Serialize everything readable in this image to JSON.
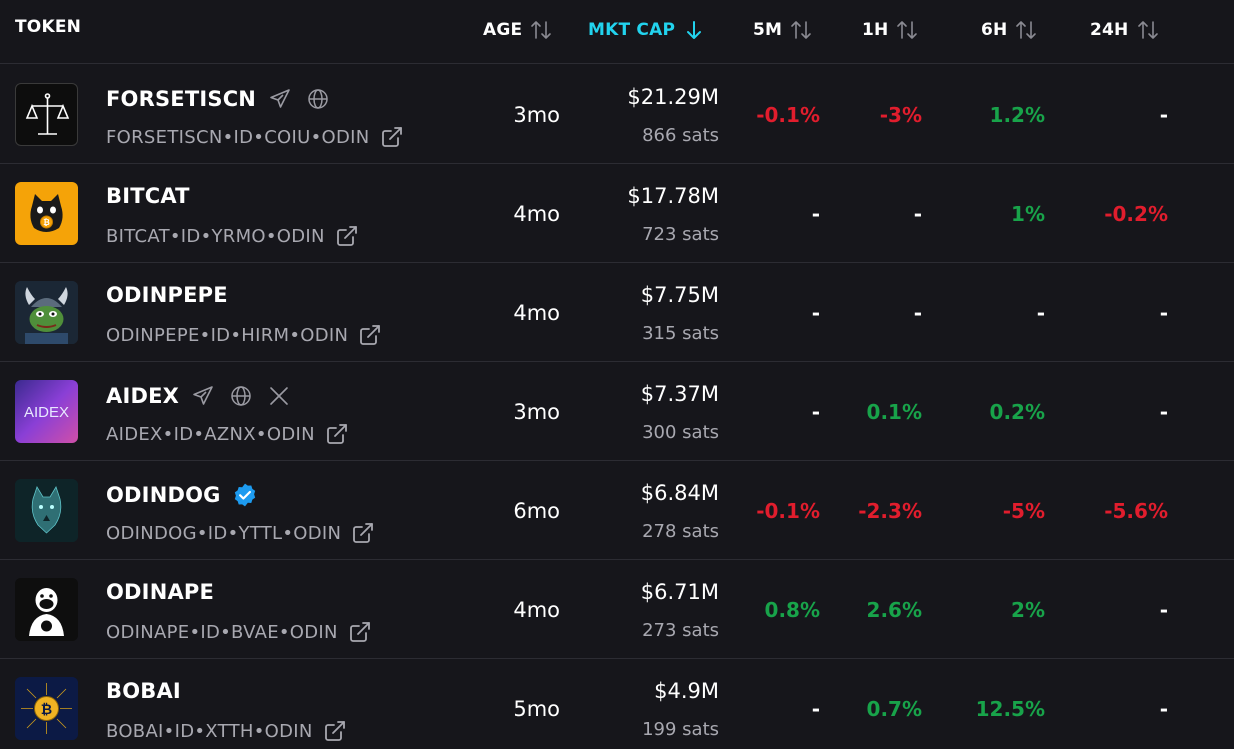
{
  "header": {
    "token": "TOKEN",
    "age": "AGE",
    "mktcap": "MKT CAP",
    "m5": "5M",
    "h1": "1H",
    "h6": "6H",
    "h24": "24H"
  },
  "colors": {
    "background": "#16161b",
    "accent": "#22d3ee",
    "positive": "#18a34a",
    "negative": "#e11d2d",
    "muted": "#a8a8b0",
    "verified": "#1d9bf0"
  },
  "rows": [
    {
      "name": "FORSETISCN",
      "id": "FORSETISCN•ID•COIU•ODIN",
      "age": "3mo",
      "cap": "$21.29M",
      "sats": "866 sats",
      "m5": "-0.1%",
      "h1": "-3%",
      "h6": "1.2%",
      "h24": "-",
      "icons": [
        "telegram-icon",
        "globe-icon"
      ]
    },
    {
      "name": "BITCAT",
      "id": "BITCAT•ID•YRMO•ODIN",
      "age": "4mo",
      "cap": "$17.78M",
      "sats": "723 sats",
      "m5": "-",
      "h1": "-",
      "h6": "1%",
      "h24": "-0.2%",
      "icons": []
    },
    {
      "name": "ODINPEPE",
      "id": "ODINPEPE•ID•HIRM•ODIN",
      "age": "4mo",
      "cap": "$7.75M",
      "sats": "315 sats",
      "m5": "-",
      "h1": "-",
      "h6": "-",
      "h24": "-",
      "icons": []
    },
    {
      "name": "AIDEX",
      "id": "AIDEX•ID•AZNX•ODIN",
      "age": "3mo",
      "cap": "$7.37M",
      "sats": "300 sats",
      "m5": "-",
      "h1": "0.1%",
      "h6": "0.2%",
      "h24": "-",
      "icons": [
        "telegram-icon",
        "globe-icon",
        "x-icon"
      ],
      "avatar_text": "AIDEX"
    },
    {
      "name": "ODINDOG",
      "id": "ODINDOG•ID•YTTL•ODIN",
      "age": "6mo",
      "cap": "$6.84M",
      "sats": "278 sats",
      "m5": "-0.1%",
      "h1": "-2.3%",
      "h6": "-5%",
      "h24": "-5.6%",
      "icons": [
        "verified-badge-icon"
      ]
    },
    {
      "name": "ODINAPE",
      "id": "ODINAPE•ID•BVAE•ODIN",
      "age": "4mo",
      "cap": "$6.71M",
      "sats": "273 sats",
      "m5": "0.8%",
      "h1": "2.6%",
      "h6": "2%",
      "h24": "-",
      "icons": []
    },
    {
      "name": "BOBAI",
      "id": "BOBAI•ID•XTTH•ODIN",
      "age": "5mo",
      "cap": "$4.9M",
      "sats": "199 sats",
      "m5": "-",
      "h1": "0.7%",
      "h6": "12.5%",
      "h24": "-",
      "icons": []
    }
  ]
}
